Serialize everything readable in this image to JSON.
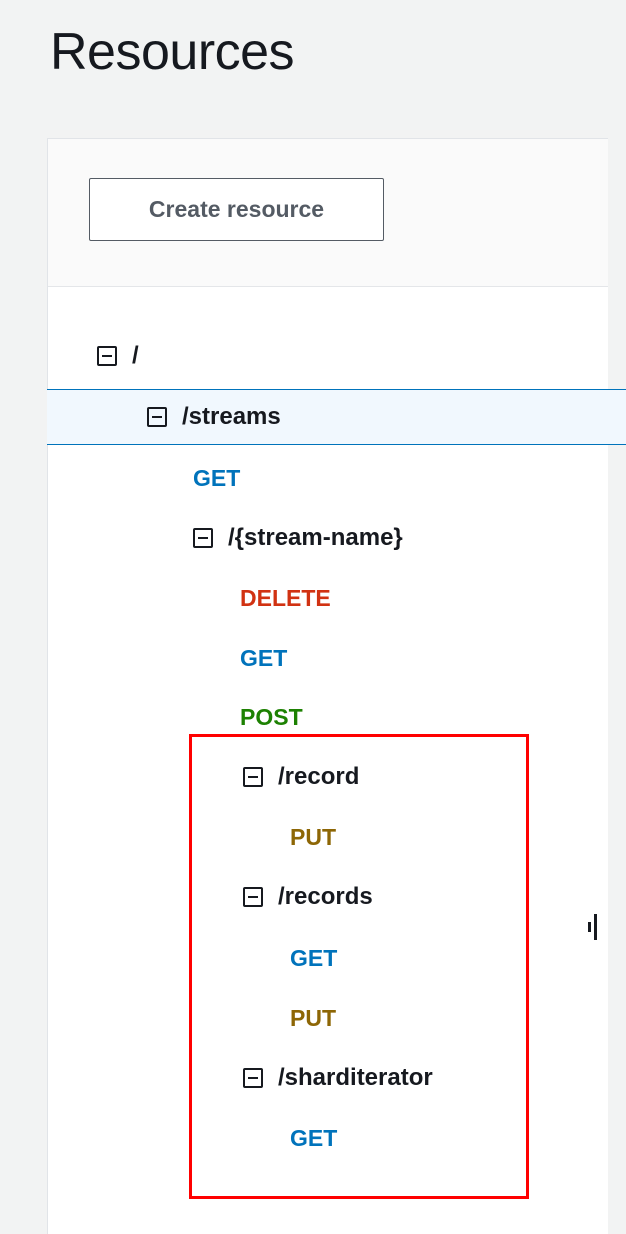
{
  "page": {
    "title": "Resources"
  },
  "toolbar": {
    "create_resource_label": "Create resource"
  },
  "tree": {
    "root": "/",
    "streams": "/streams",
    "streams_get": "GET",
    "stream_name": "/{stream-name}",
    "stream_name_delete": "DELETE",
    "stream_name_get": "GET",
    "stream_name_post": "POST",
    "record": "/record",
    "record_put": "PUT",
    "records": "/records",
    "records_get": "GET",
    "records_put": "PUT",
    "sharditerator": "/sharditerator",
    "sharditerator_get": "GET"
  },
  "colors": {
    "get": "#0073bb",
    "delete": "#d13212",
    "post": "#1d8102",
    "put": "#8d6605",
    "highlight": "#ff0000",
    "selected_bg": "#f1f8fe"
  },
  "icons": {
    "toggle": "collapse-square-icon"
  }
}
